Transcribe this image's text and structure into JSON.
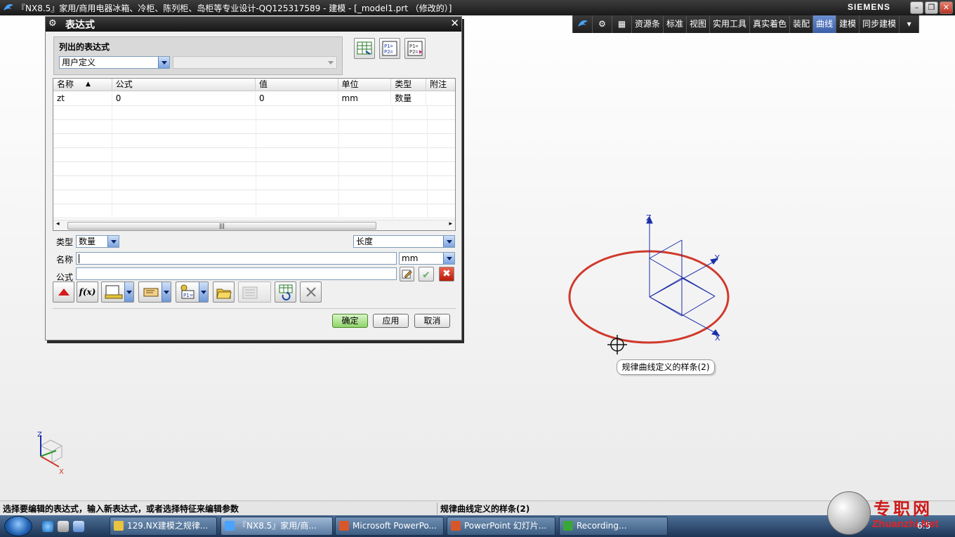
{
  "window": {
    "title": "『NX8.5』家用/商用电器冰箱、冷柜、陈列柜、岛柜等专业设计-QQ125317589 - 建模 - [_model1.prt （修改的）]",
    "brand": "SIEMENS",
    "minimize_icon": "minimize-icon",
    "restore_icon": "restore-icon",
    "close_icon": "close-icon"
  },
  "app_tabs": {
    "items": [
      "资源条",
      "标准",
      "视图",
      "实用工具",
      "真实着色",
      "装配",
      "曲线",
      "建模",
      "同步建模"
    ],
    "selected": "曲线"
  },
  "dialog": {
    "title": "表达式",
    "listed_label": "列出的表达式",
    "filter_value": "用户定义",
    "secondary_value": "",
    "columns": [
      "名称",
      "公式",
      "值",
      "单位",
      "类型",
      "附注"
    ],
    "rows": [
      {
        "name": "zt",
        "formula": "0",
        "value": "0",
        "unit": "mm",
        "type": "数量",
        "note": ""
      }
    ],
    "type_label": "类型",
    "type_value": "数量",
    "dimension_value": "长度",
    "name_label": "名称",
    "name_value": "",
    "unit_value": "mm",
    "formula_label": "公式",
    "formula_value": "",
    "ok_label": "确定",
    "apply_label": "应用",
    "cancel_label": "取消",
    "fx_label": "f(x)"
  },
  "viewport": {
    "tooltip": "规律曲线定义的样条(2)",
    "axis_z": "Z",
    "axis_y": "Y",
    "axis_x": "X"
  },
  "status": {
    "prompt": "选择要编辑的表达式，输入新表达式，或者选择特征来编辑参数",
    "selection": "规律曲线定义的样条(2)"
  },
  "taskbar": {
    "tasks": [
      "129.NX建模之规律...",
      "『NX8.5』家用/商...",
      "Microsoft PowerPo...",
      "PowerPoint 幻灯片...",
      "Recording..."
    ],
    "clock": "6:5"
  },
  "watermark": {
    "cn": "专职网",
    "url": "Zhuanzhi.Net"
  },
  "colors": {
    "ellipse": "#d0392b",
    "axis": "#1b2ea8",
    "tab_selected": "#4a6fb8"
  }
}
